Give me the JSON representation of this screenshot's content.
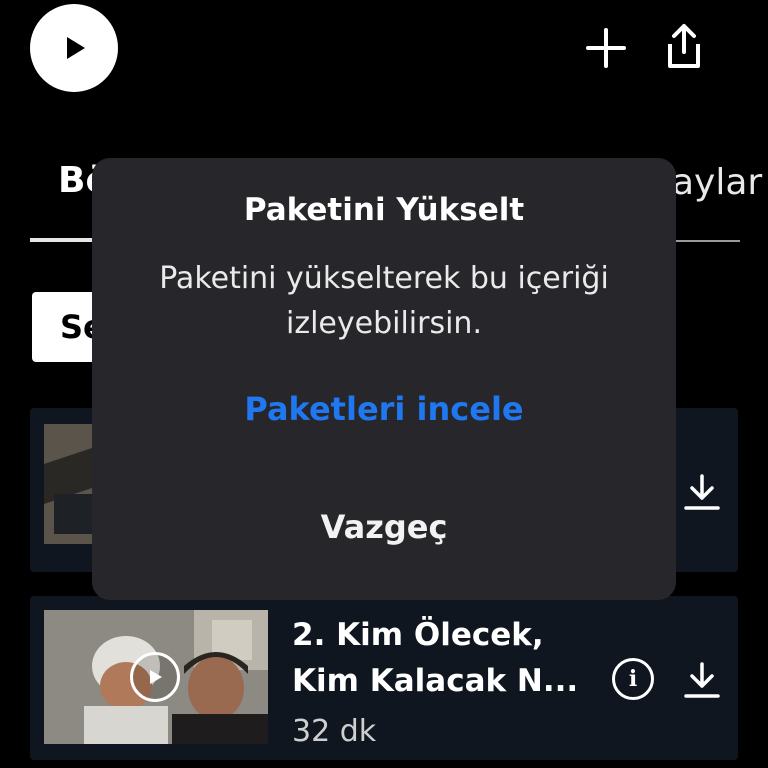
{
  "header": {
    "play_icon": "play-icon",
    "add_icon": "plus-icon",
    "share_icon": "share-icon"
  },
  "tabs": {
    "left_label": "Bö",
    "right_label": "aylar"
  },
  "season_chip": {
    "label": "Se"
  },
  "episodes": [
    {
      "title_line1": "",
      "title_line2": "",
      "duration": ""
    },
    {
      "title_line1": "2. Kim Ölecek,",
      "title_line2": "Kim Kalacak N...",
      "duration": "32 dk"
    }
  ],
  "dialog": {
    "title": "Paketini Yükselt",
    "message": "Paketini yükselterek bu içeriği izleyebilirsin.",
    "primary_action": "Paketleri incele",
    "cancel_action": "Vazgeç"
  },
  "colors": {
    "background": "#000000",
    "dialog_bg": "#27262b",
    "accent_blue": "#1f78f0",
    "card_bg": "#0f1620"
  }
}
